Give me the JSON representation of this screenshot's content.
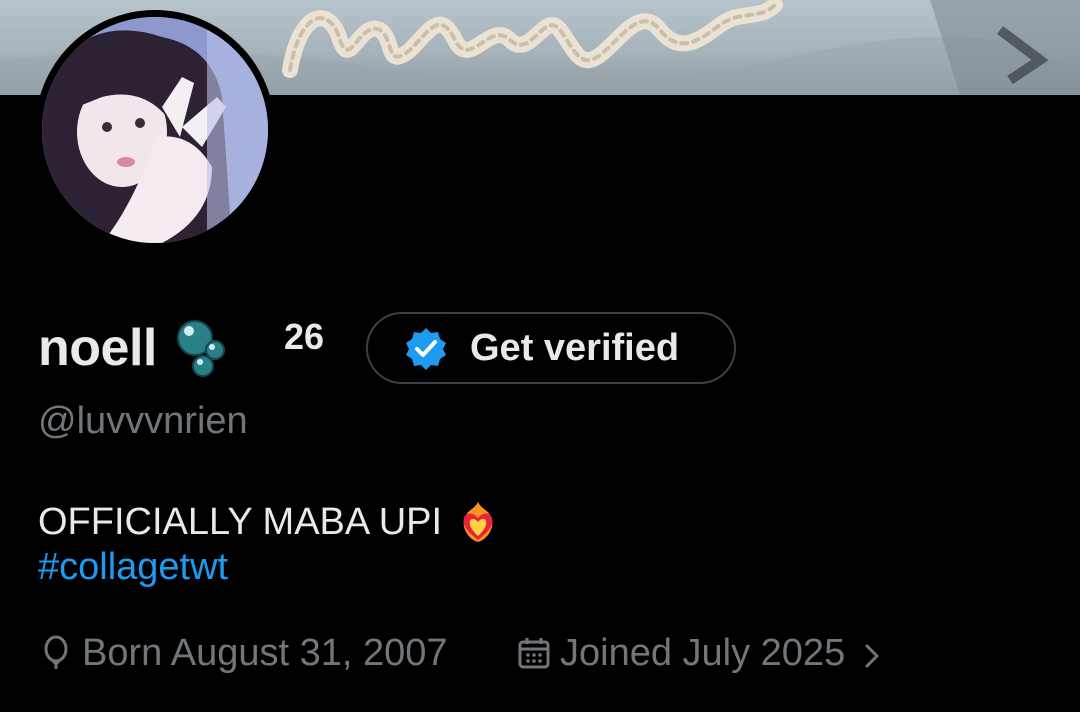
{
  "profile": {
    "display_name": "noell",
    "name_suffix": "26",
    "name_emoji": "bubbles-icon",
    "handle": "@luvvvnrien",
    "bio_text": "OFFICIALLY MABA UPI",
    "bio_emoji": "heart-on-fire-icon",
    "hashtag": "#collagetwt",
    "born": "Born August 31, 2007",
    "joined": "Joined July 2025"
  },
  "actions": {
    "verify_label": "Get verified"
  },
  "colors": {
    "background": "#000000",
    "primary_text": "#e7e9ea",
    "secondary_text": "#71767b",
    "link": "#1d9bf0",
    "button_border": "#3e4144"
  }
}
